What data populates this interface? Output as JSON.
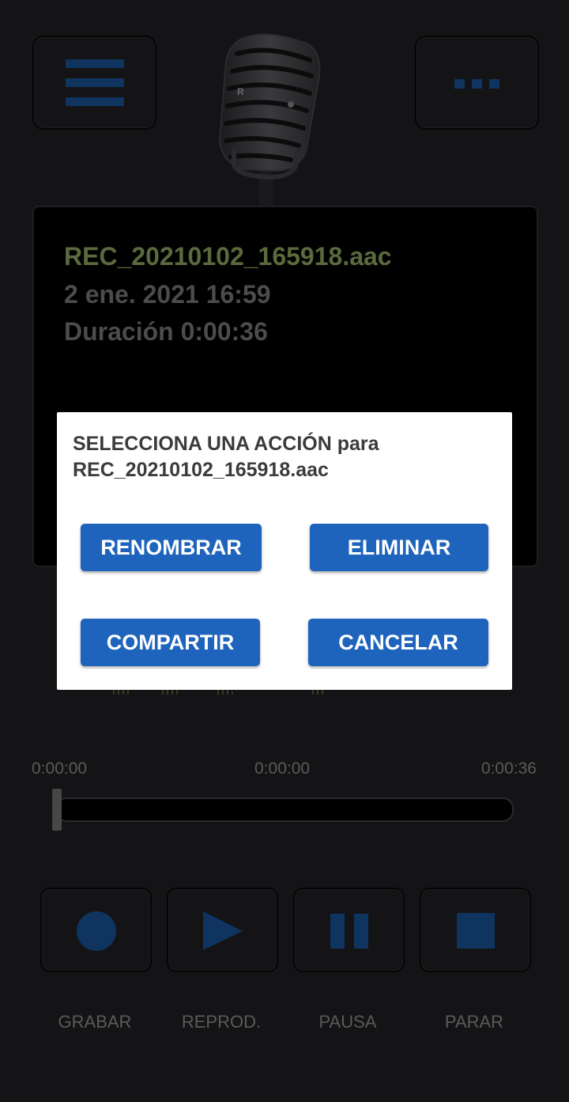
{
  "header": {
    "menu_icon": "hamburger-menu-icon",
    "more_icon": "ellipsis-icon",
    "mic_icon": "microphone-icon",
    "accent_color": "#0f3460"
  },
  "recording": {
    "file_name": "REC_20210102_165918.aac",
    "date": "2 ene. 2021 16:59",
    "duration": "Duración 0:00:36"
  },
  "dialog": {
    "title": "SELECCIONA UNA ACCIÓN para REC_20210102_165918.aac",
    "rename_label": "RENOMBRAR",
    "delete_label": "ELIMINAR",
    "share_label": "COMPARTIR",
    "cancel_label": "CANCELAR",
    "button_color": "#1e64bd"
  },
  "seekbar": {
    "start_time": "0:00:00",
    "current_time": "0:00:00",
    "end_time": "0:00:36",
    "progress": 0
  },
  "controls": {
    "record_label": "GRABAR",
    "play_label": "REPROD.",
    "pause_label": "PAUSA",
    "stop_label": "PARAR"
  }
}
